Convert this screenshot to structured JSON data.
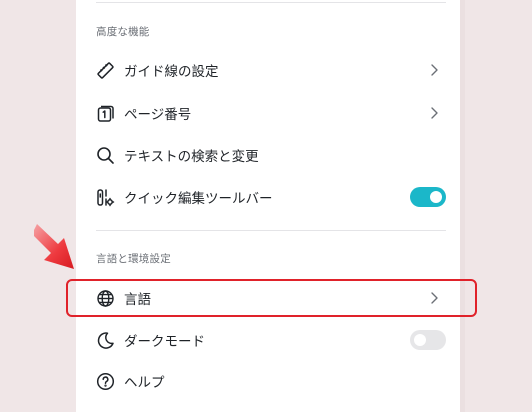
{
  "sections": {
    "advanced_title": "高度な機能",
    "language_title": "言語と環境設定"
  },
  "items": {
    "guides": {
      "label": "ガイド線の設定",
      "icon": "ruler-icon"
    },
    "page_number": {
      "label": "ページ番号",
      "icon": "page-number-icon"
    },
    "find_replace": {
      "label": "テキストの検索と変更",
      "icon": "search-icon"
    },
    "quick_toolbar": {
      "label": "クイック編集ツールバー",
      "icon": "quick-edit-icon",
      "enabled": true
    },
    "language": {
      "label": "言語",
      "icon": "globe-icon"
    },
    "dark_mode": {
      "label": "ダークモード",
      "icon": "moon-icon",
      "enabled": false
    },
    "help": {
      "label": "ヘルプ",
      "icon": "help-circle-icon"
    }
  },
  "colors": {
    "toggle_on": "#1bb7c9",
    "toggle_off": "#e6e6e8",
    "highlight": "#e0222a",
    "background": "#f0e6e7"
  }
}
